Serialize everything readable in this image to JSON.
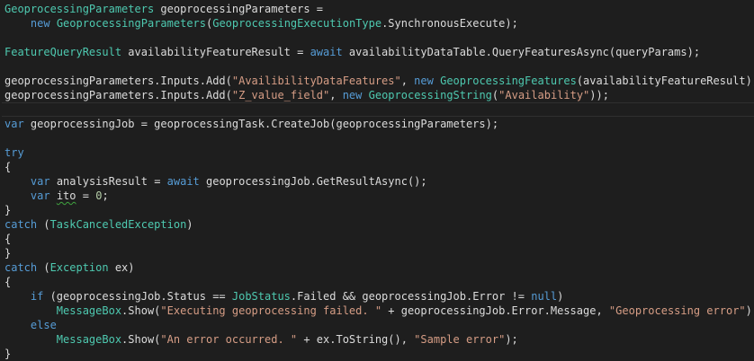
{
  "editor": {
    "language": "C#",
    "colors": {
      "background": "#1e1e1e",
      "keyword": "#569cd6",
      "type": "#4ec9b0",
      "string": "#d69d85",
      "number": "#b5cea8",
      "plain": "#dcdcdc",
      "warning_squiggle": "#3fa33f"
    },
    "current_line_index": 7,
    "squiggle_token": "ito",
    "lines": [
      [
        [
          "ty",
          "GeoprocessingParameters"
        ],
        [
          "pl",
          " geoprocessingParameters ="
        ]
      ],
      [
        [
          "pl",
          "    "
        ],
        [
          "kw",
          "new"
        ],
        [
          "pl",
          " "
        ],
        [
          "ty",
          "GeoprocessingParameters"
        ],
        [
          "pl",
          "("
        ],
        [
          "ty",
          "GeoprocessingExecutionType"
        ],
        [
          "pl",
          ".SynchronousExecute);"
        ]
      ],
      [],
      [
        [
          "ty",
          "FeatureQueryResult"
        ],
        [
          "pl",
          " availabilityFeatureResult = "
        ],
        [
          "kw",
          "await"
        ],
        [
          "pl",
          " availabilityDataTable.QueryFeaturesAsync(queryParams);"
        ]
      ],
      [],
      [
        [
          "pl",
          "geoprocessingParameters.Inputs.Add("
        ],
        [
          "st",
          "\"AvailibilityDataFeatures\""
        ],
        [
          "pl",
          ", "
        ],
        [
          "kw",
          "new"
        ],
        [
          "pl",
          " "
        ],
        [
          "ty",
          "GeoprocessingFeatures"
        ],
        [
          "pl",
          "(availabilityFeatureResult));"
        ]
      ],
      [
        [
          "pl",
          "geoprocessingParameters.Inputs.Add("
        ],
        [
          "st",
          "\"Z_value_field\""
        ],
        [
          "pl",
          ", "
        ],
        [
          "kw",
          "new"
        ],
        [
          "pl",
          " "
        ],
        [
          "ty",
          "GeoprocessingString"
        ],
        [
          "pl",
          "("
        ],
        [
          "st",
          "\"Availability\""
        ],
        [
          "pl",
          "));"
        ]
      ],
      [],
      [
        [
          "kw",
          "var"
        ],
        [
          "pl",
          " geoprocessingJob = geoprocessingTask.CreateJob(geoprocessingParameters);"
        ]
      ],
      [],
      [
        [
          "kw",
          "try"
        ]
      ],
      [
        [
          "pl",
          "{"
        ]
      ],
      [
        [
          "pl",
          "    "
        ],
        [
          "kw",
          "var"
        ],
        [
          "pl",
          " analysisResult = "
        ],
        [
          "kw",
          "await"
        ],
        [
          "pl",
          " geoprocessingJob.GetResultAsync();"
        ]
      ],
      [
        [
          "pl",
          "    "
        ],
        [
          "kw",
          "var"
        ],
        [
          "pl",
          " "
        ],
        [
          "sq",
          "ito"
        ],
        [
          "pl",
          " = "
        ],
        [
          "nu",
          "0"
        ],
        [
          "pl",
          ";"
        ]
      ],
      [
        [
          "pl",
          "}"
        ]
      ],
      [
        [
          "kw",
          "catch"
        ],
        [
          "pl",
          " ("
        ],
        [
          "ty",
          "TaskCanceledException"
        ],
        [
          "pl",
          ")"
        ]
      ],
      [
        [
          "pl",
          "{"
        ]
      ],
      [
        [
          "pl",
          "}"
        ]
      ],
      [
        [
          "kw",
          "catch"
        ],
        [
          "pl",
          " ("
        ],
        [
          "ty",
          "Exception"
        ],
        [
          "pl",
          " ex)"
        ]
      ],
      [
        [
          "pl",
          "{"
        ]
      ],
      [
        [
          "pl",
          "    "
        ],
        [
          "kw",
          "if"
        ],
        [
          "pl",
          " (geoprocessingJob.Status == "
        ],
        [
          "ty",
          "JobStatus"
        ],
        [
          "pl",
          ".Failed && geoprocessingJob.Error != "
        ],
        [
          "kw",
          "null"
        ],
        [
          "pl",
          ")"
        ]
      ],
      [
        [
          "pl",
          "        "
        ],
        [
          "ty",
          "MessageBox"
        ],
        [
          "pl",
          ".Show("
        ],
        [
          "st",
          "\"Executing geoprocessing failed. \""
        ],
        [
          "pl",
          " + geoprocessingJob.Error.Message, "
        ],
        [
          "st",
          "\"Geoprocessing error\""
        ],
        [
          "pl",
          ");"
        ]
      ],
      [
        [
          "pl",
          "    "
        ],
        [
          "kw",
          "else"
        ]
      ],
      [
        [
          "pl",
          "        "
        ],
        [
          "ty",
          "MessageBox"
        ],
        [
          "pl",
          ".Show("
        ],
        [
          "st",
          "\"An error occurred. \""
        ],
        [
          "pl",
          " + ex.ToString(), "
        ],
        [
          "st",
          "\"Sample error\""
        ],
        [
          "pl",
          ");"
        ]
      ],
      [
        [
          "pl",
          "}"
        ]
      ]
    ]
  }
}
